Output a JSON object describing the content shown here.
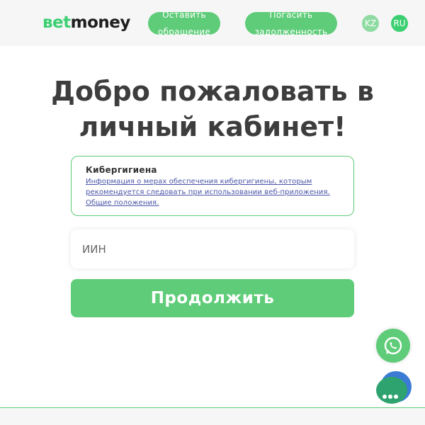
{
  "header": {
    "logo_accent": "вet",
    "logo_main": "money",
    "appeal_button": "Оставить обращение",
    "debt_button": "Погасить задолженность",
    "lang_kz": "KZ",
    "lang_ru": "RU"
  },
  "main": {
    "title": "Добро пожаловать в личный кабинет!",
    "notice": {
      "title": "Кибергигиена",
      "link_text": "Информация о мерах обеспечения кибергигиены, которым рекомендуется следовать при использовании веб-приложения.",
      "link_general": "Общие положения."
    },
    "iin_placeholder": "ИИН",
    "iin_value": "",
    "continue_button": "Продолжить"
  },
  "widgets": {
    "whatsapp_icon": "whatsapp-icon",
    "chat_icon": "chat-dots-icon"
  },
  "colors": {
    "accent": "#5ecc78",
    "logo_green": "#3ccf72",
    "link": "#4a55a8",
    "chat_blue": "#3a7bd5"
  }
}
